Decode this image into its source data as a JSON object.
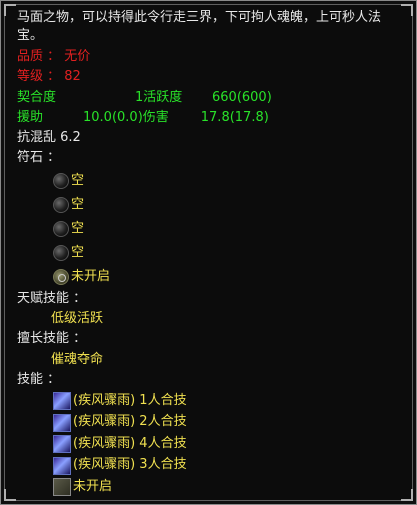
{
  "description": "马面之物，可以持得此令行走三界，下可拘人魂魄，上可秒人法宝。",
  "quality": {
    "label": "品质 ： ",
    "value": "无价"
  },
  "level": {
    "label": "等级 ： ",
    "value": "82"
  },
  "stats": {
    "affinity_label": "契合度",
    "activity_label": "1活跃度",
    "activity_value": "660(600)",
    "aid_label": "援助",
    "aid_value": "10.0(0.0)",
    "damage_label": "伤害",
    "damage_value": "17.8(17.8)"
  },
  "chaos_resist": "抗混乱 6.2",
  "rune_header": "符石 ：",
  "rune_slots": [
    "空",
    "空",
    "空",
    "空"
  ],
  "rune_locked": "未开启",
  "talent_header": "天赋技能 ：",
  "talent_value": "低级活跃",
  "specialty_header": "擅长技能 ：",
  "specialty_value": "催魂夺命",
  "skills_header": "技能 ：",
  "skills": [
    {
      "name": "(疾风骤雨)",
      "detail": "1人合技"
    },
    {
      "name": "(疾风骤雨)",
      "detail": "2人合技"
    },
    {
      "name": "(疾风骤雨)",
      "detail": "4人合技"
    },
    {
      "name": "(疾风骤雨)",
      "detail": "3人合技"
    }
  ],
  "skill_locked": "未开启",
  "colors": {
    "red": "#e02020",
    "green": "#29e229",
    "yellow": "#f0e050",
    "white": "#e8e8e8"
  }
}
